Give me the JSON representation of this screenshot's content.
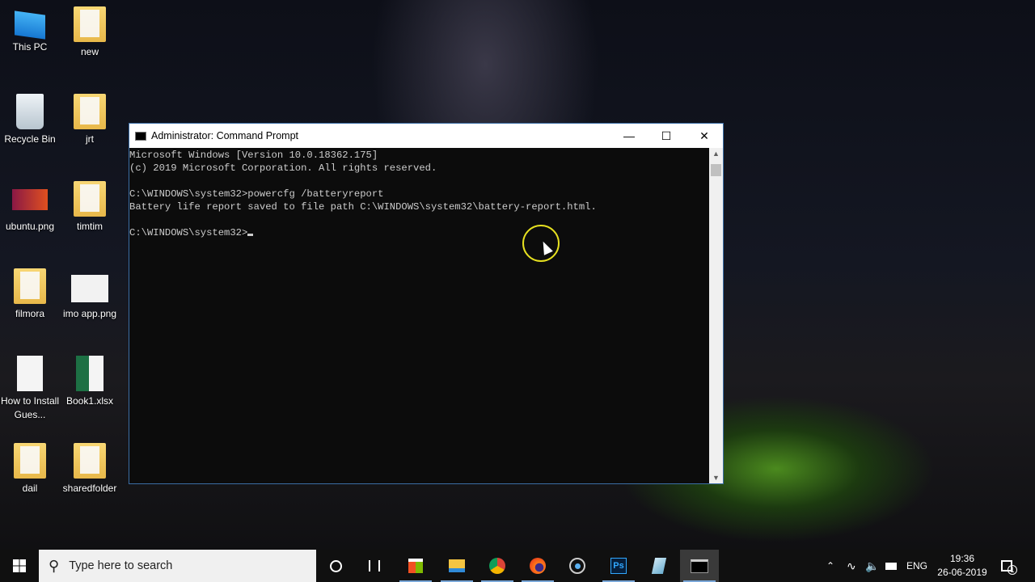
{
  "desktop": {
    "icons": [
      {
        "label": "This PC",
        "icon": "computer-icon"
      },
      {
        "label": "new",
        "icon": "folder-icon"
      },
      {
        "label": "Recycle Bin",
        "icon": "recycle-bin-icon"
      },
      {
        "label": "jrt",
        "icon": "folder-icon"
      },
      {
        "label": "ubuntu.png",
        "icon": "image-icon"
      },
      {
        "label": "timtim",
        "icon": "folder-icon"
      },
      {
        "label": "filmora",
        "icon": "folder-shortcut-icon"
      },
      {
        "label": "imo app.png",
        "icon": "image-icon"
      },
      {
        "label": "How to Install Gues...",
        "icon": "document-icon"
      },
      {
        "label": "Book1.xlsx",
        "icon": "excel-icon"
      },
      {
        "label": "dail",
        "icon": "folder-shortcut-icon"
      },
      {
        "label": "sharedfolder",
        "icon": "folder-icon"
      }
    ]
  },
  "window": {
    "title": "Administrator: Command Prompt",
    "lines": [
      "Microsoft Windows [Version 10.0.18362.175]",
      "(c) 2019 Microsoft Corporation. All rights reserved.",
      "",
      "C:\\WINDOWS\\system32>powercfg /batteryreport",
      "Battery life report saved to file path C:\\WINDOWS\\system32\\battery-report.html.",
      "",
      "C:\\WINDOWS\\system32>"
    ]
  },
  "taskbar": {
    "search_placeholder": "Type here to search",
    "language": "ENG",
    "time": "19:36",
    "date": "26-06-2019",
    "notifications": "1",
    "apps": [
      "cortana",
      "task-view",
      "store",
      "file-explorer",
      "chrome",
      "firefox",
      "media",
      "photoshop",
      "notepad",
      "command-prompt"
    ]
  }
}
